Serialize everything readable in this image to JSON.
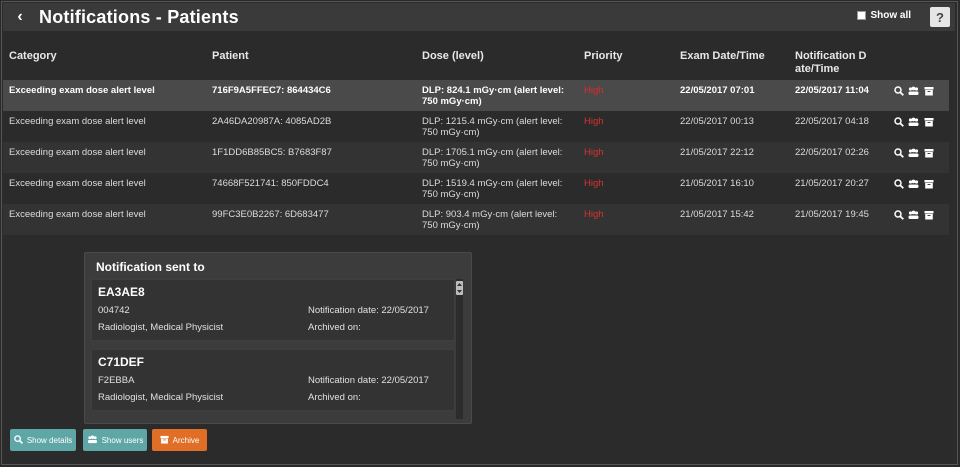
{
  "header": {
    "title": "Notifications - Patients",
    "back_icon": "‹",
    "show_all_label": "Show all",
    "help_label": "?"
  },
  "table": {
    "columns": {
      "category": "Category",
      "patient": "Patient",
      "dose": "Dose (level)",
      "priority": "Priority",
      "exam_date": "Exam Date/Time",
      "notif_date_line1": "Notification D",
      "notif_date_line2": "ate/Time"
    },
    "rows": [
      {
        "category": "Exceeding exam dose alert level",
        "patient": "716F9A5FFEC7: 864434C6",
        "dose_line1": "DLP: 824.1 mGy·cm (alert level:",
        "dose_line2": "750 mGy·cm)",
        "priority": "High",
        "exam_date": "22/05/2017 07:01",
        "notif_date": "22/05/2017 11:04"
      },
      {
        "category": "Exceeding exam dose alert level",
        "patient": "2A46DA20987A: 4085AD2B",
        "dose_line1": "DLP: 1215.4 mGy·cm (alert level:",
        "dose_line2": "750 mGy·cm)",
        "priority": "High",
        "exam_date": "22/05/2017 00:13",
        "notif_date": "22/05/2017 04:18"
      },
      {
        "category": "Exceeding exam dose alert level",
        "patient": "1F1DD6B85BC5: B7683F87",
        "dose_line1": "DLP: 1705.1 mGy·cm (alert level:",
        "dose_line2": "750 mGy·cm)",
        "priority": "High",
        "exam_date": "21/05/2017 22:12",
        "notif_date": "22/05/2017 02:26"
      },
      {
        "category": "Exceeding exam dose alert level",
        "patient": "74668F521741: 850FDDC4",
        "dose_line1": "DLP: 1519.4 mGy·cm (alert level:",
        "dose_line2": "750 mGy·cm)",
        "priority": "High",
        "exam_date": "21/05/2017 16:10",
        "notif_date": "21/05/2017 20:27"
      },
      {
        "category": "Exceeding exam dose alert level",
        "patient": "99FC3E0B2267: 6D683477",
        "dose_line1": "DLP: 903.4 mGy·cm (alert level:",
        "dose_line2": "750 mGy·cm)",
        "priority": "High",
        "exam_date": "21/05/2017 15:42",
        "notif_date": "21/05/2017 19:45"
      }
    ],
    "action_icons": {
      "zoom": "⚲",
      "users": "👥",
      "archive": "▣"
    }
  },
  "panel": {
    "title": "Notification sent to",
    "recipients": [
      {
        "code": "EA3AE8",
        "sub": "004742",
        "roles": "Radiologist, Medical Physicist",
        "notification_date": "Notification date: 22/05/2017",
        "archived": "Archived on:"
      },
      {
        "code": "C71DEF",
        "sub": "F2EBBA",
        "roles": "Radiologist, Medical Physicist",
        "notification_date": "Notification date: 22/05/2017",
        "archived": "Archived on:"
      }
    ]
  },
  "buttons": {
    "show_details": "Show details",
    "show_users": "Show users",
    "archive": "Archive"
  },
  "colors": {
    "priority_high": "#d9322f",
    "teal_button": "#5fa6a6",
    "archive_button": "#e06e27"
  }
}
